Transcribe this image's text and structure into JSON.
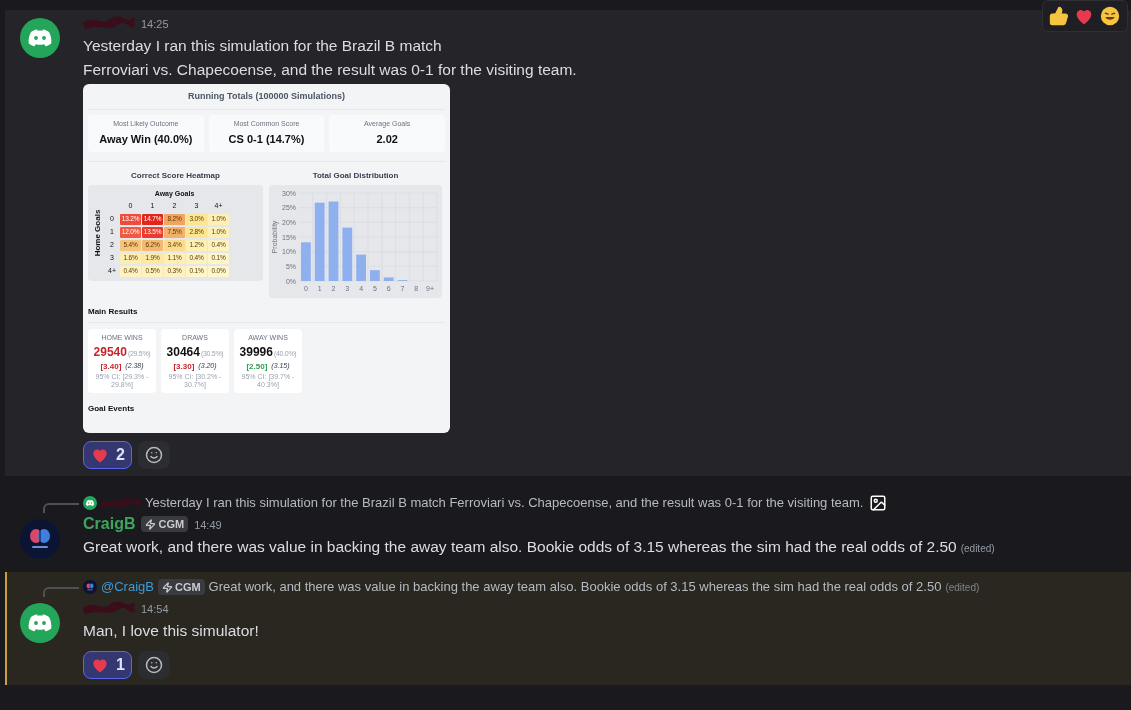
{
  "messages": [
    {
      "avatar": {
        "kind": "discord"
      },
      "time": "14:25",
      "hovered": true,
      "highlighted": false,
      "lines": [
        "Yesterday I ran this simulation for the Brazil B match",
        "Ferroviari vs. Chapecoense, and the result was 0-1 for the visiting team."
      ],
      "attachment": {
        "title": "Running Totals (100000 Simulations)",
        "stats": [
          {
            "label": "Most Likely Outcome",
            "value": "Away Win (40.0%)"
          },
          {
            "label": "Most Common Score",
            "value": "CS 0-1 (14.7%)"
          },
          {
            "label": "Average Goals",
            "value": "2.02"
          }
        ],
        "heatmap": {
          "title": "Correct Score Heatmap",
          "x_axis": "Away Goals",
          "y_axis": "Home Goals",
          "columns": [
            "0",
            "1",
            "2",
            "3",
            "4+"
          ],
          "rows": [
            {
              "label": "0",
              "cells": [
                {
                  "text": "13.2%",
                  "color": "#ef4b3c"
                },
                {
                  "text": "14.7%",
                  "color": "#e3261c"
                },
                {
                  "text": "8.2%",
                  "color": "#f2a45e"
                },
                {
                  "text": "3.0%",
                  "color": "#fde592"
                },
                {
                  "text": "1.0%",
                  "color": "#fef0b4"
                }
              ]
            },
            {
              "label": "1",
              "cells": [
                {
                  "text": "12.0%",
                  "color": "#f05a42"
                },
                {
                  "text": "13.5%",
                  "color": "#ea3c2e"
                },
                {
                  "text": "7.5%",
                  "color": "#f4b06a"
                },
                {
                  "text": "2.8%",
                  "color": "#fde592"
                },
                {
                  "text": "1.0%",
                  "color": "#fef0b4"
                }
              ]
            },
            {
              "label": "2",
              "cells": [
                {
                  "text": "5.4%",
                  "color": "#f6c47a"
                },
                {
                  "text": "6.2%",
                  "color": "#f4b872"
                },
                {
                  "text": "3.4%",
                  "color": "#fcdc8c"
                },
                {
                  "text": "1.2%",
                  "color": "#feefb2"
                },
                {
                  "text": "0.4%",
                  "color": "#fef3c0"
                }
              ]
            },
            {
              "label": "3",
              "cells": [
                {
                  "text": "1.6%",
                  "color": "#feeeae"
                },
                {
                  "text": "1.9%",
                  "color": "#fde9a4"
                },
                {
                  "text": "1.1%",
                  "color": "#feefb2"
                },
                {
                  "text": "0.4%",
                  "color": "#fef3c0"
                },
                {
                  "text": "0.1%",
                  "color": "#fef5c8"
                }
              ]
            },
            {
              "label": "4+",
              "cells": [
                {
                  "text": "0.4%",
                  "color": "#fef3c0"
                },
                {
                  "text": "0.5%",
                  "color": "#fef3c0"
                },
                {
                  "text": "0.3%",
                  "color": "#fef3c0"
                },
                {
                  "text": "0.1%",
                  "color": "#fef5c8"
                },
                {
                  "text": "0.0%",
                  "color": "#fef6cc"
                }
              ]
            }
          ]
        },
        "distribution": {
          "chart_data": {
            "type": "bar",
            "title": "Total Goal Distribution",
            "ylabel": "Probability",
            "grid": true,
            "categories": [
              "0",
              "1",
              "2",
              "3",
              "4",
              "5",
              "6",
              "7",
              "8",
              "9+"
            ],
            "series": [
              {
                "color": "#8fb0ee",
                "values": [
                  13.2,
                  26.7,
                  27.1,
                  18.2,
                  9.0,
                  3.7,
                  1.2,
                  0.3,
                  null,
                  0.0
                ]
              }
            ],
            "ylim": [
              0,
              30
            ],
            "yticks": [
              {
                "value": 0,
                "label": "0%"
              },
              {
                "value": 5,
                "label": "5%"
              },
              {
                "value": 10,
                "label": "10%"
              },
              {
                "value": 15,
                "label": "15%"
              },
              {
                "value": 20,
                "label": "20%"
              },
              {
                "value": 25,
                "label": "25%"
              },
              {
                "value": 30,
                "label": "30%"
              }
            ]
          }
        },
        "results_title": "Main Results",
        "results": [
          {
            "label": "HOME WINS",
            "count": "29540",
            "percent": "(29.5%)",
            "color": "#c8242c",
            "odds": {
              "text": "[3.40]",
              "color": "#c8242c"
            },
            "implied": "(2.38)",
            "ci": "95% CI: [29.3% - 29.8%]"
          },
          {
            "label": "DRAWS",
            "count": "30464",
            "percent": "(30.5%)",
            "color": "#111111",
            "odds": {
              "text": "[3.30]",
              "color": "#c8242c"
            },
            "implied": "(3.20)",
            "ci": "95% CI: [30.2% - 30.7%]"
          },
          {
            "label": "AWAY WINS",
            "count": "39996",
            "percent": "(40.0%)",
            "color": "#111111",
            "odds": {
              "text": "[2.50]",
              "color": "#2f9e4f"
            },
            "implied": "(3.15)",
            "ci": "95% CI: [39.7% - 40.3%]"
          }
        ],
        "next_section": "Goal Events"
      },
      "reactions": [
        {
          "count": "2",
          "selected": true
        }
      ]
    },
    {
      "avatar": {
        "kind": "brain"
      },
      "author": "CraigB",
      "badge": "CGM",
      "time": "14:49",
      "hovered": false,
      "highlighted": false,
      "reply": {
        "avatar": {
          "kind": "discord"
        },
        "text": "Yesterday I ran this simulation for the Brazil B match Ferroviari vs. Chapecoense, and the result was 0-1 for the visiting team.",
        "has_image": true
      },
      "lines": [
        "Great work, and there was value in backing the away team also. Bookie odds of 3.15 whereas the sim had the real odds of 2.50"
      ],
      "edited": "(edited)"
    },
    {
      "avatar": {
        "kind": "discord"
      },
      "time": "14:54",
      "hovered": false,
      "highlighted": true,
      "reply": {
        "avatar": {
          "kind": "brain"
        },
        "mention": "@CraigB",
        "badge": "CGM",
        "text": "Great work, and there was value in backing the away team also. Bookie odds of 3.15 whereas the sim had the real odds of 2.50",
        "edited": "(edited)"
      },
      "lines": [
        "Man, I love this simulator!"
      ],
      "reactions": [
        {
          "count": "1",
          "selected": true
        }
      ]
    }
  ]
}
